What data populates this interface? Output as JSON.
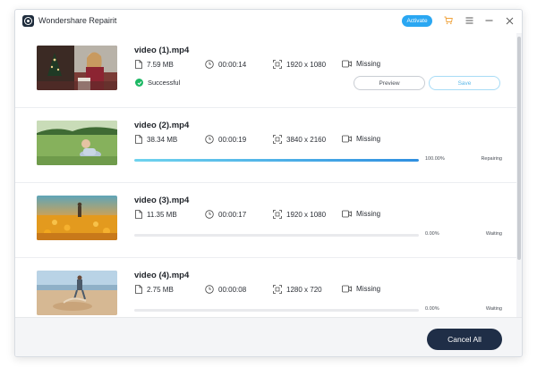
{
  "app": {
    "title": "Wondershare Repairit",
    "activate_label": "Activate"
  },
  "videos": [
    {
      "name": "video (1).mp4",
      "size": "7.59  MB",
      "duration": "00:00:14",
      "resolution": "1920 x 1080",
      "audio": "Missing",
      "status": "Successful",
      "preview_label": "Preview",
      "save_label": "Save"
    },
    {
      "name": "video (2).mp4",
      "size": "38.34  MB",
      "duration": "00:00:19",
      "resolution": "3840 x 2160",
      "audio": "Missing",
      "progress": 100,
      "progress_text": "100.00%",
      "state": "Repairing"
    },
    {
      "name": "video (3).mp4",
      "size": "11.35  MB",
      "duration": "00:00:17",
      "resolution": "1920 x 1080",
      "audio": "Missing",
      "progress": 0,
      "progress_text": "0.00%",
      "state": "Waiting"
    },
    {
      "name": "video (4).mp4",
      "size": "2.75  MB",
      "duration": "00:00:08",
      "resolution": "1280 x 720",
      "audio": "Missing",
      "progress": 0,
      "progress_text": "0.00%",
      "state": "Waiting"
    }
  ],
  "footer": {
    "cancel_all_label": "Cancel All"
  },
  "colors": {
    "accent": "#2aa7f2",
    "success": "#1cb864",
    "cancel_bg": "#1f2e47",
    "cart": "#f0a23a"
  },
  "icons": {
    "file": "file-icon",
    "clock": "clock-icon",
    "resolution": "resolution-icon",
    "audio": "video-camera-icon"
  }
}
